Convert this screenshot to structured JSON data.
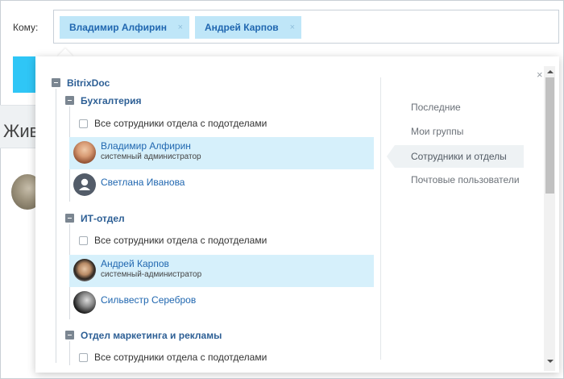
{
  "to_label": "Кому:",
  "recipients": [
    {
      "name": "Владимир Алфирин",
      "remove": "×"
    },
    {
      "name": "Андрей Карпов",
      "remove": "×"
    }
  ],
  "background": {
    "strip_text": "Жив"
  },
  "popup": {
    "close": "×",
    "root": "BitrixDoc",
    "all_employees_label": "Все сотрудники отдела с подотделами",
    "departments": [
      {
        "name": "Бухгалтерия",
        "users": [
          {
            "name": "Владимир Алфирин",
            "position": "системный администратор",
            "selected": true
          },
          {
            "name": "Светлана Иванова",
            "position": "",
            "selected": false
          }
        ]
      },
      {
        "name": "ИТ-отдел",
        "users": [
          {
            "name": "Андрей Карпов",
            "position": "системный-администратор",
            "selected": true
          },
          {
            "name": "Сильвестр Серебров",
            "position": "",
            "selected": false
          }
        ]
      },
      {
        "name": "Отдел маркетинга и рекламы",
        "users": []
      }
    ],
    "menu": [
      {
        "label": "Последние",
        "active": false
      },
      {
        "label": "Мои группы",
        "active": false
      },
      {
        "label": "Сотрудники и отделы",
        "active": true
      },
      {
        "label": "Почтовые пользователи",
        "active": false
      }
    ]
  },
  "colors": {
    "chip_bg": "#bfe6f8",
    "chip_text": "#2067b0",
    "selected_row": "#d6f0fb",
    "department_title": "#2d5f95",
    "accent_button": "#2fc6f6"
  }
}
